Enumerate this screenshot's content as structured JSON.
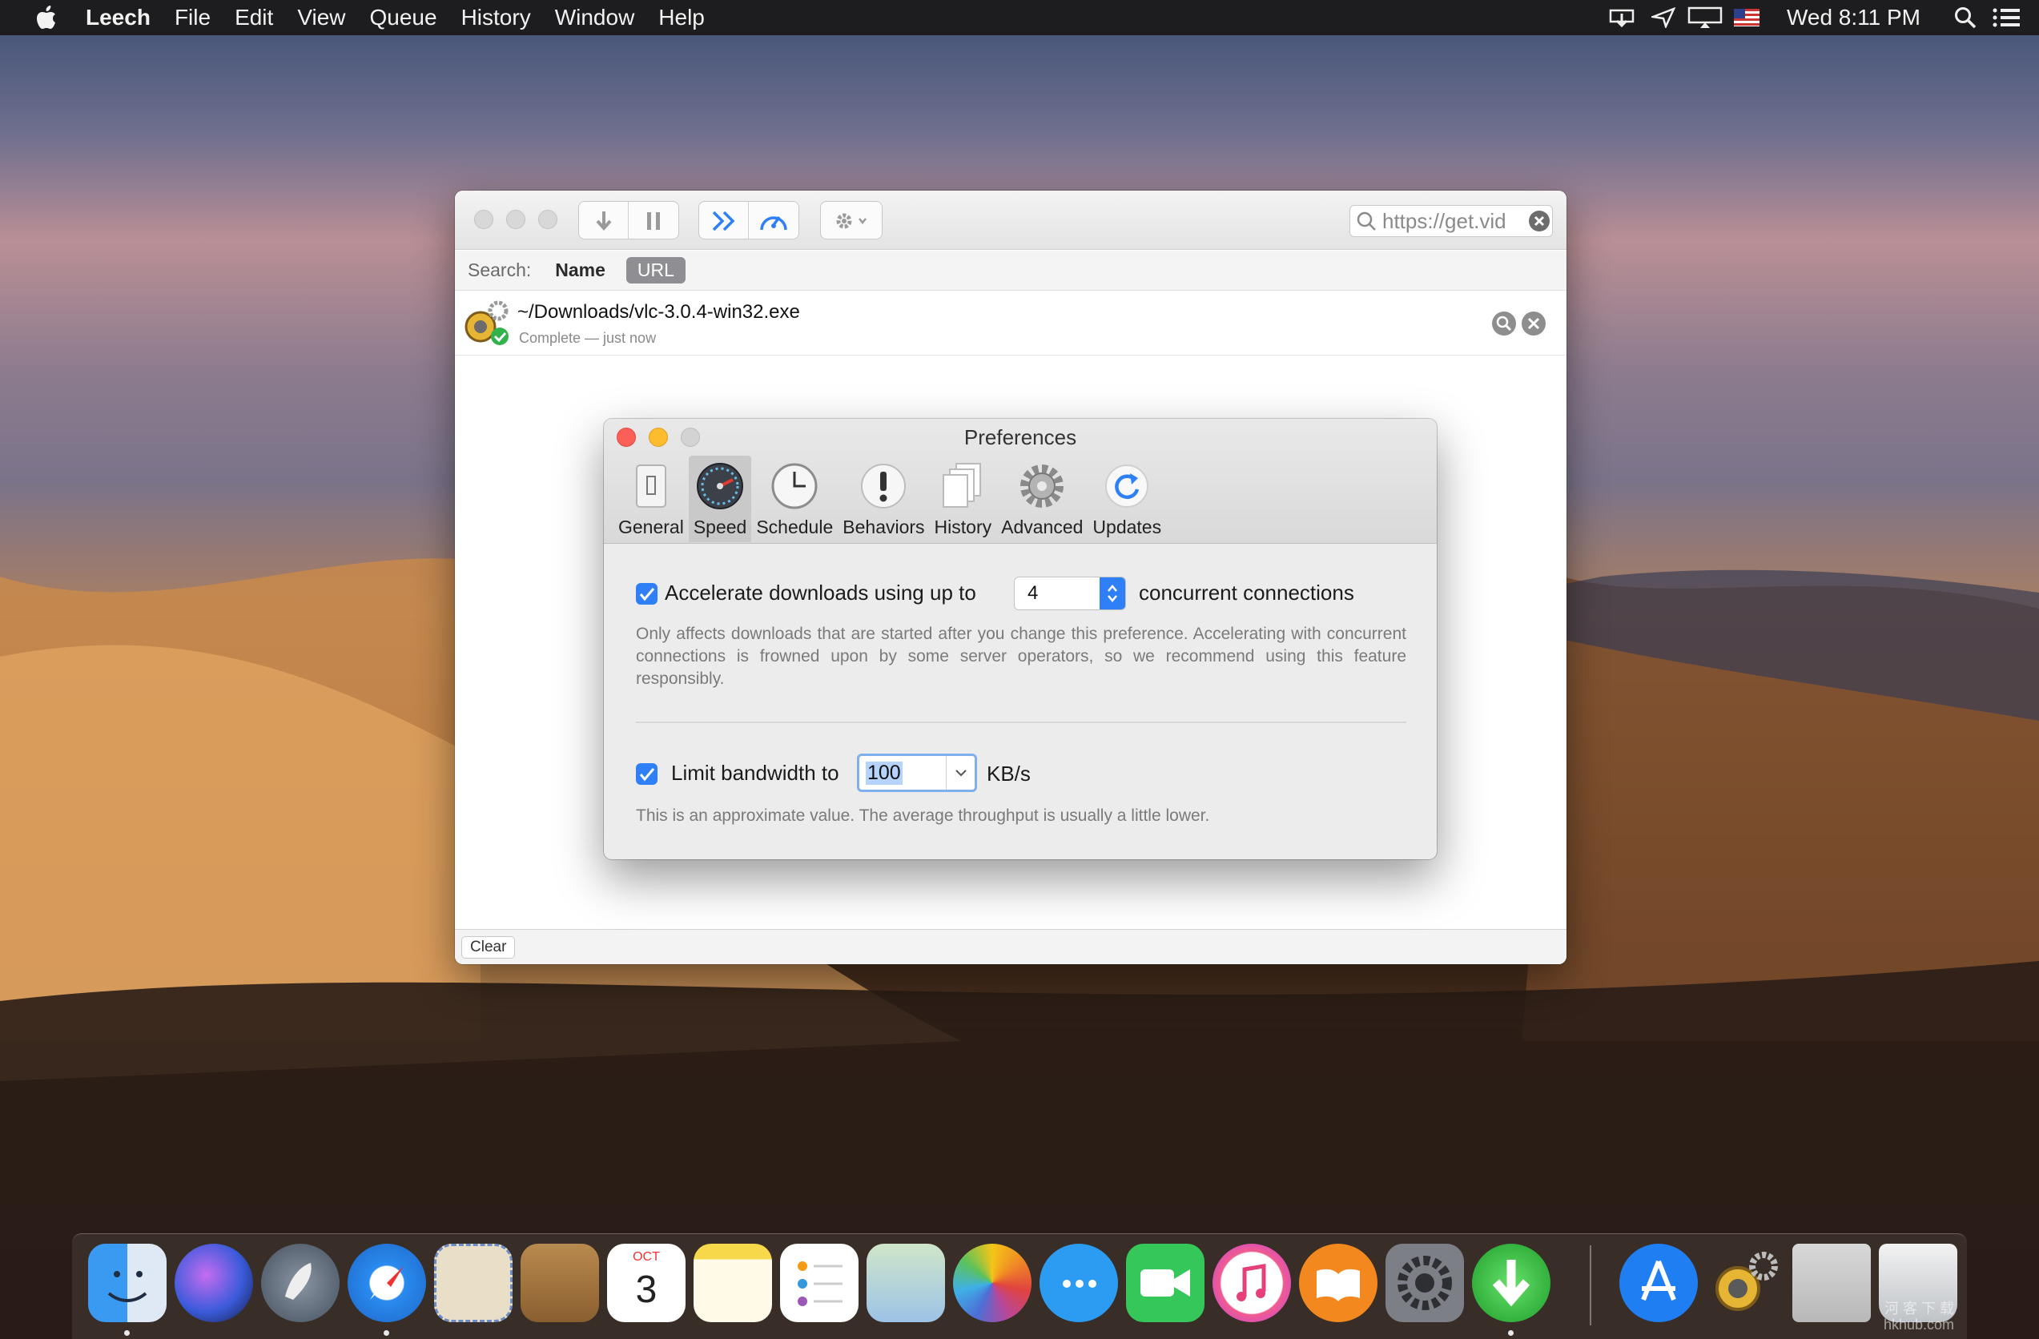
{
  "menubar": {
    "app_name": "Leech",
    "items": [
      "File",
      "Edit",
      "View",
      "Queue",
      "History",
      "Window",
      "Help"
    ],
    "clock": "Wed 8:11 PM"
  },
  "leech_window": {
    "url_field_value": "https://get.vid",
    "search": {
      "label": "Search:",
      "options": [
        "Name",
        "URL"
      ],
      "selected": "URL"
    },
    "downloads": [
      {
        "filename": "~/Downloads/vlc-3.0.4-win32.exe",
        "status": "Complete — just now"
      }
    ],
    "clear_label": "Clear"
  },
  "preferences": {
    "title": "Preferences",
    "tabs": [
      "General",
      "Speed",
      "Schedule",
      "Behaviors",
      "History",
      "Advanced",
      "Updates"
    ],
    "active_tab": "Speed",
    "accelerate": {
      "checked": true,
      "label_before": "Accelerate downloads using up to",
      "connections_value": "4",
      "label_after": "concurrent connections",
      "description": "Only affects downloads that are started after you change this preference. Accelerating with concurrent connections is frowned upon by some server operators, so we recommend using this feature responsibly."
    },
    "bandwidth": {
      "checked": true,
      "label_before": "Limit bandwidth to",
      "value": "100",
      "unit": "KB/s",
      "description": "This is an approximate value. The average throughput is usually a little lower."
    }
  },
  "dock": {
    "calendar_month": "OCT",
    "calendar_day": "3"
  },
  "watermark": {
    "line1": "河 客 下 载",
    "line2": "hkhub.com"
  },
  "colors": {
    "accent": "#2f80f6",
    "close": "#fc5f57",
    "minimize": "#fdbc2e",
    "menubar": "#1d1d1f"
  }
}
